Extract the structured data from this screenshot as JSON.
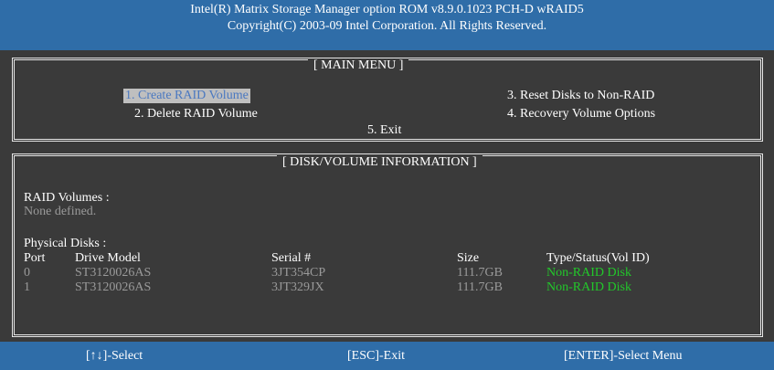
{
  "header": {
    "line1": "Intel(R) Matrix Storage Manager option ROM v8.9.0.1023 PCH-D wRAID5",
    "line2": "Copyright(C) 2003-09 Intel Corporation.  All Rights Reserved."
  },
  "main_menu": {
    "title": "[ MAIN MENU ]",
    "items": [
      {
        "label": "1.  Create RAID Volume",
        "selected": true
      },
      {
        "label": "2.  Delete RAID Volume"
      },
      {
        "label": "3.  Reset Disks to Non-RAID"
      },
      {
        "label": "4.  Recovery Volume Options"
      },
      {
        "label": "5.  Exit"
      }
    ]
  },
  "disk_info": {
    "title": "[ DISK/VOLUME INFORMATION ]",
    "raid_volumes_label": "RAID Volumes :",
    "raid_volumes_value": "None defined.",
    "physical_disks_label": "Physical Disks :",
    "columns": [
      "Port",
      "Drive Model",
      "Serial #",
      "Size",
      "Type/Status(Vol ID)"
    ],
    "disks": [
      {
        "port": "0",
        "model": "ST3120026AS",
        "serial": "3JT354CP",
        "size": "111.7GB",
        "status": "Non-RAID Disk"
      },
      {
        "port": "1",
        "model": "ST3120026AS",
        "serial": "3JT329JX",
        "size": "111.7GB",
        "status": "Non-RAID Disk"
      }
    ]
  },
  "footer": {
    "select": "[↑↓]-Select",
    "exit": "[ESC]-Exit",
    "enter": "[ENTER]-Select Menu"
  },
  "colors": {
    "header_bg": "#2f6da8",
    "body_bg": "#3a3a3a",
    "status_green": "#22c82a",
    "selected_bg": "#bfbfbf",
    "selected_fg": "#4a78c0"
  }
}
